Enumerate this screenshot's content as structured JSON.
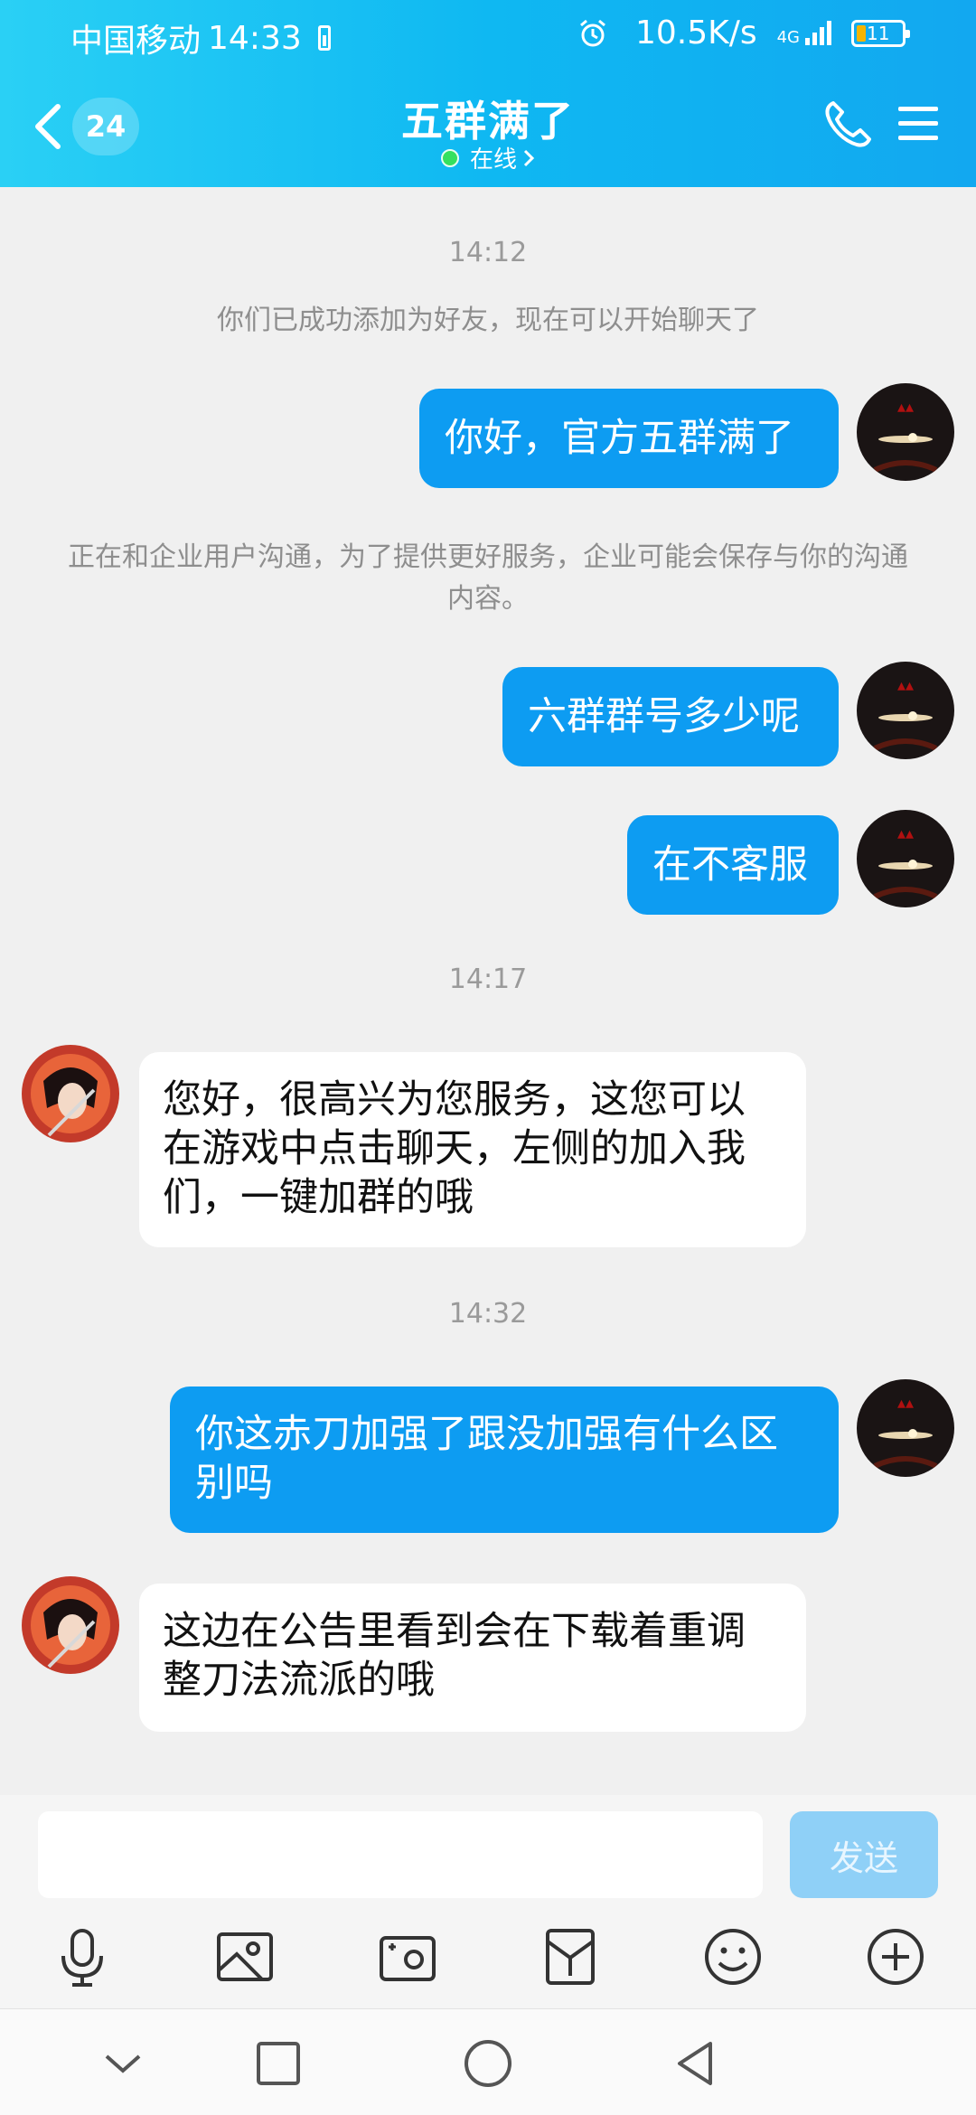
{
  "status_bar": {
    "carrier": "中国移动",
    "time": "14:33",
    "net_speed": "10.5K/s",
    "network_type": "4G",
    "battery_level": "11",
    "icons": [
      "alarm-icon",
      "signal-icon",
      "battery-icon"
    ]
  },
  "header": {
    "unread_count": "24",
    "chat_title": "五群满了",
    "presence": "在线",
    "presence_color": "#34e05e",
    "accent_color": "#0fb8f2"
  },
  "messages": [
    {
      "type": "time",
      "text": "14:12"
    },
    {
      "type": "system",
      "text": "你们已成功添加为好友，现在可以开始聊天了"
    },
    {
      "type": "me",
      "text": "你好，官方五群满了"
    },
    {
      "type": "system",
      "text": "正在和企业用户沟通，为了提供更好服务，企业可能会保存与你的沟通内容。"
    },
    {
      "type": "me",
      "text": "六群群号多少呢"
    },
    {
      "type": "me",
      "text": "在不客服"
    },
    {
      "type": "time",
      "text": "14:17"
    },
    {
      "type": "them",
      "text": "您好，很高兴为您服务，这您可以在游戏中点击聊天，左侧的加入我们，一键加群的哦"
    },
    {
      "type": "time",
      "text": "14:32"
    },
    {
      "type": "me",
      "text": "你这赤刀加强了跟没加强有什么区别吗"
    },
    {
      "type": "them",
      "text": "这边在公告里看到会在下载着重调整刀法流派的哦"
    }
  ],
  "composer": {
    "input_value": "",
    "send_label": "发送",
    "send_color": "#8fd0f7"
  },
  "toolbar_icons": [
    "microphone-icon",
    "image-icon",
    "camera-icon",
    "red-packet-icon",
    "emoji-icon",
    "plus-icon"
  ],
  "nav_icons": [
    "chevron-down-icon",
    "recent-apps-icon",
    "home-icon",
    "back-icon"
  ]
}
